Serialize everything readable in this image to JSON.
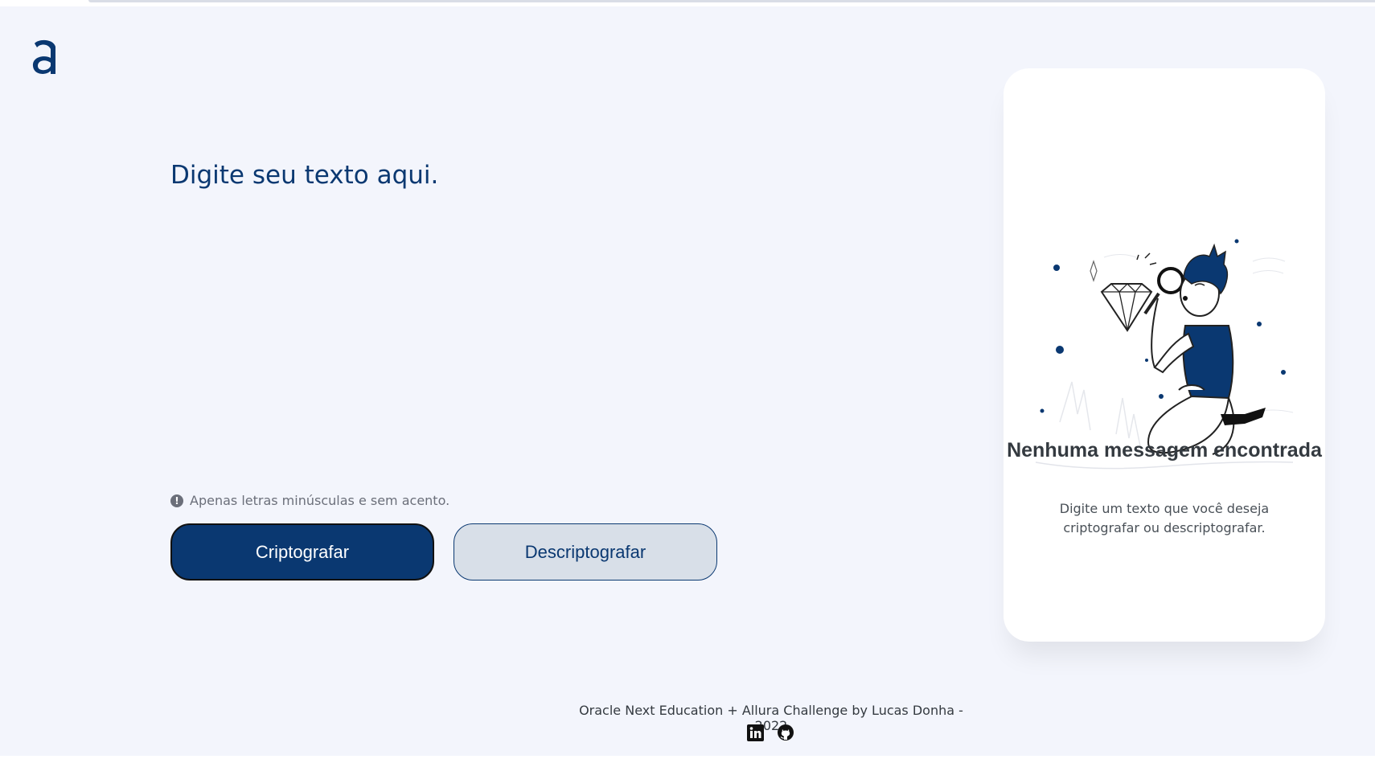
{
  "header": {
    "logo_icon": "alura-logo"
  },
  "editor": {
    "placeholder": "Digite seu texto aqui.",
    "value": ""
  },
  "hint": {
    "icon": "exclamation-circle-icon",
    "text": "Apenas letras minúsculas e sem acento."
  },
  "actions": {
    "encrypt_label": "Criptografar",
    "decrypt_label": "Descriptografar"
  },
  "result_panel": {
    "illustration": "person-with-magnifier-and-diamond",
    "title": "Nenhuma messagem encontrada",
    "description": "Digite um texto que você deseja criptografar ou descriptografar."
  },
  "footer": {
    "credit": "Oracle Next Education + Allura Challenge by Lucas Donha - 2022",
    "links": [
      {
        "icon": "linkedin-icon"
      },
      {
        "icon": "github-icon"
      }
    ]
  },
  "colors": {
    "background": "#f3f5fc",
    "primary": "#0a3871",
    "secondary_bg": "#d8dfe8",
    "card_bg": "#ffffff"
  }
}
